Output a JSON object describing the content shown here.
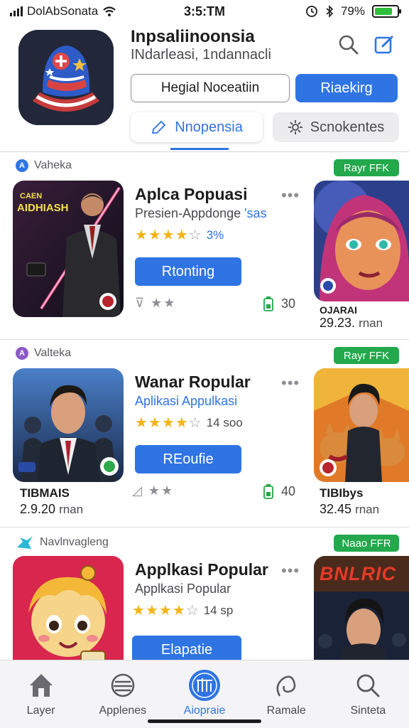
{
  "status": {
    "carrier": "DolAbSonata",
    "time": "3:5:TM",
    "battery_pct": "79%",
    "battery_fill": 0.79
  },
  "header": {
    "title": "Inpsaliinoonsia",
    "subtitle": "INdarleasi, 1ndannacli",
    "btn_secondary": "Hegial Noceatiin",
    "btn_primary": "Riaekirg",
    "seg_active": "Nnopensia",
    "seg_inactive": "Scnokentes"
  },
  "cards": [
    {
      "category": "Vaheka",
      "badge": "Rayr FFK",
      "title": "Aplca Popuasi",
      "subtitle": "Presien-Appdonge",
      "subtitle_accent": "'sas",
      "rating": 4,
      "rating_value": "3%",
      "button": "Rtonting",
      "meta": "⊽ ★★",
      "count": "30",
      "icon_text_1": "CAEN",
      "icon_text_2": "AIDHIASH",
      "side_label": "OJARAI",
      "side_price": "29.23.",
      "side_unit": "rnan"
    },
    {
      "category": "Valteka",
      "badge": "Rayr FFK",
      "title": "Wanar Ropular",
      "subtitle": "Aplikasi Appulkasi",
      "rating": 4,
      "rating_value": "14 soo",
      "button": "REoufie",
      "meta": "◿ ★★",
      "count": "40",
      "left_label": "TIBMAIS",
      "left_price": "2.9.20",
      "left_unit": "rnan",
      "side_label": "TIBIbys",
      "side_price": "32.45",
      "side_unit": "rnan"
    },
    {
      "category": "Navlnvagleng",
      "badge": "Naao FFR",
      "title": "Applkasi Popular",
      "subtitle": "Applkasi Popular",
      "rating": 4,
      "rating_value": "14 sp",
      "button": "Elapatie",
      "side_icon_text": "BNLRIC"
    }
  ],
  "tabs": [
    {
      "label": "Layer",
      "icon": "house-icon"
    },
    {
      "label": "Applenes",
      "icon": "stack-icon"
    },
    {
      "label": "Aiopraie",
      "icon": "bars-icon",
      "active": true
    },
    {
      "label": "Ramale",
      "icon": "swirl-icon"
    },
    {
      "label": "Sinteta",
      "icon": "search-icon"
    }
  ],
  "colors": {
    "accent": "#2f74e3",
    "badge": "#23a84b",
    "star": "#f3b416"
  }
}
